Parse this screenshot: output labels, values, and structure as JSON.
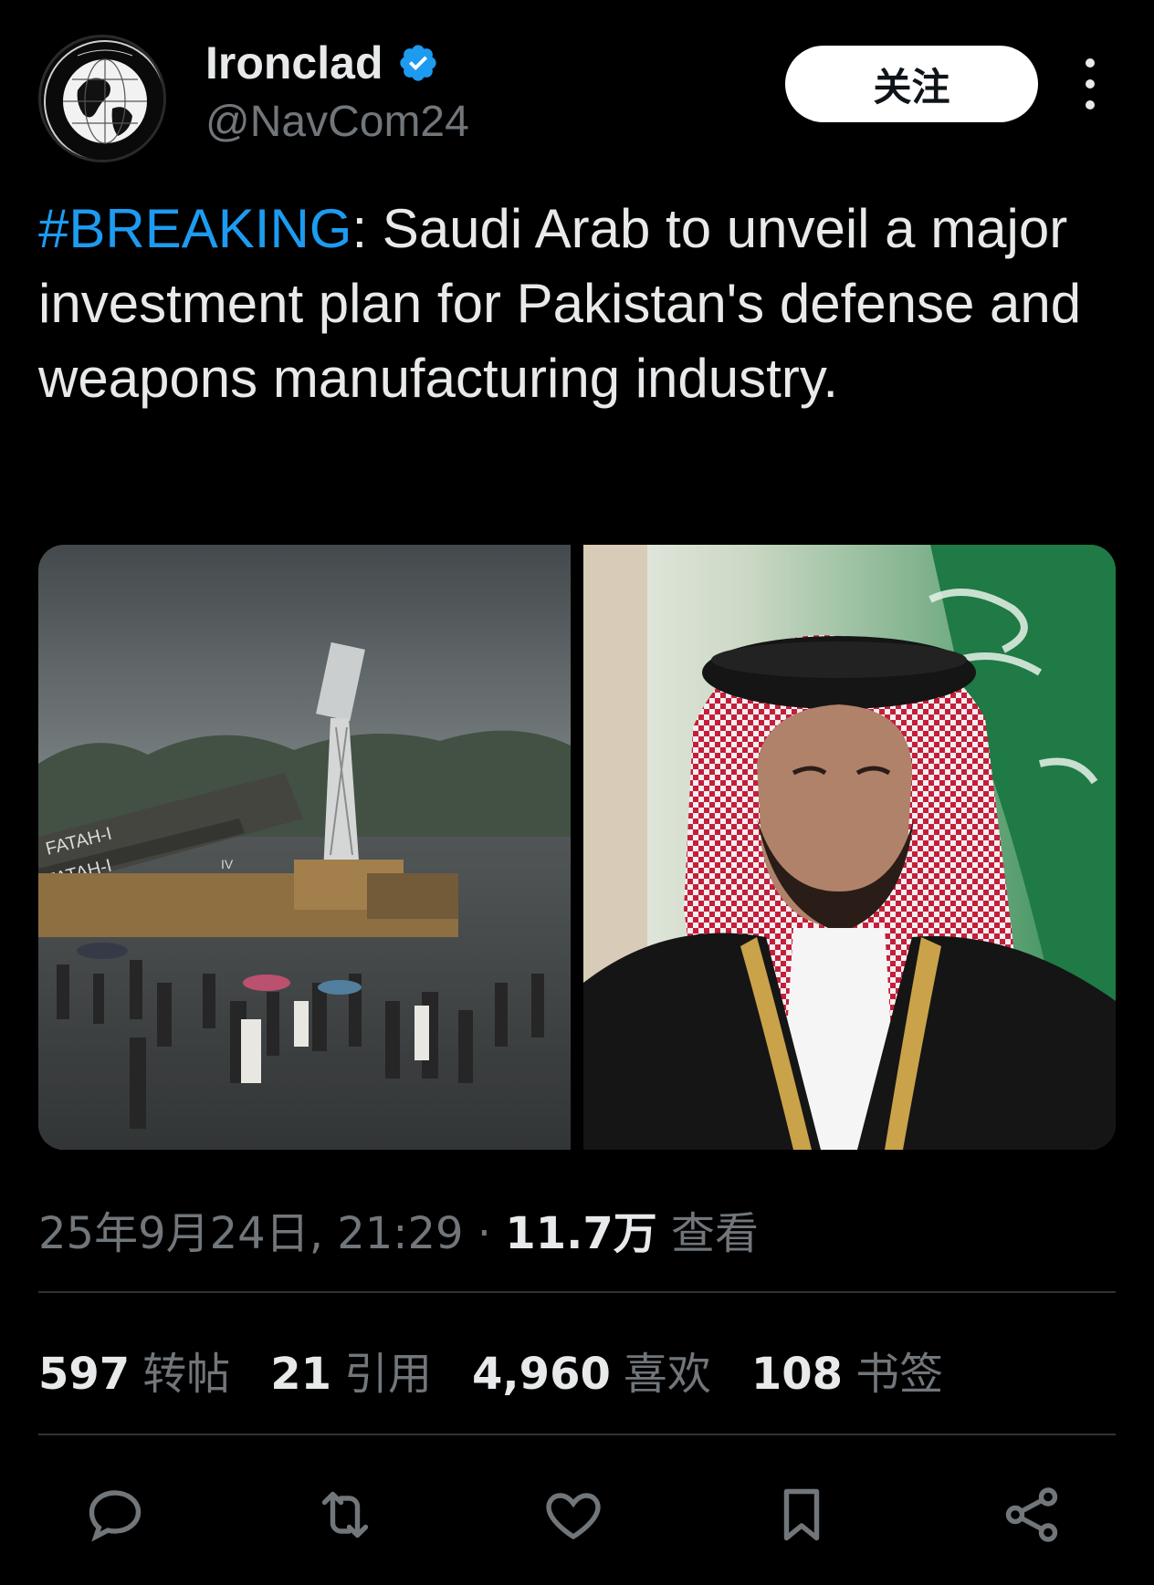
{
  "author": {
    "name": "Ironclad",
    "handle": "@NavCom24",
    "avatar_ring_text": "IRONCLAD",
    "avatar_motto": "RESILIENCE THROUGH INFORMATION SUPERIORITY"
  },
  "follow_label": "关注",
  "tweet": {
    "hashtag": "#BREAKING",
    "body": ": Saudi Arab to unveil a major investment plan for Pakistan's defense and weapons manufacturing industry."
  },
  "media": [
    {
      "label": "FATAH-I rocket launcher exhibition in rain",
      "vehicle_text_1": "FATAH-I",
      "vehicle_text_2": "FATAH-I",
      "vehicle_text_3": "IV"
    },
    {
      "label": "portrait with Saudi flag"
    }
  ],
  "meta": {
    "timestamp": "25年9月24日, 21:29",
    "separator": " · ",
    "views_count": "11.7万",
    "views_label": " 查看"
  },
  "stats": [
    {
      "count": "597",
      "label": "转帖"
    },
    {
      "count": "21",
      "label": "引用"
    },
    {
      "count": "4,960",
      "label": "喜欢"
    },
    {
      "count": "108",
      "label": "书签"
    }
  ],
  "actions": [
    "reply-icon",
    "retweet-icon",
    "like-icon",
    "bookmark-icon",
    "share-icon"
  ],
  "colors": {
    "background": "#000000",
    "accent": "#1d9bf0",
    "secondary_text": "#71767b",
    "primary_text": "#e7e9ea"
  }
}
